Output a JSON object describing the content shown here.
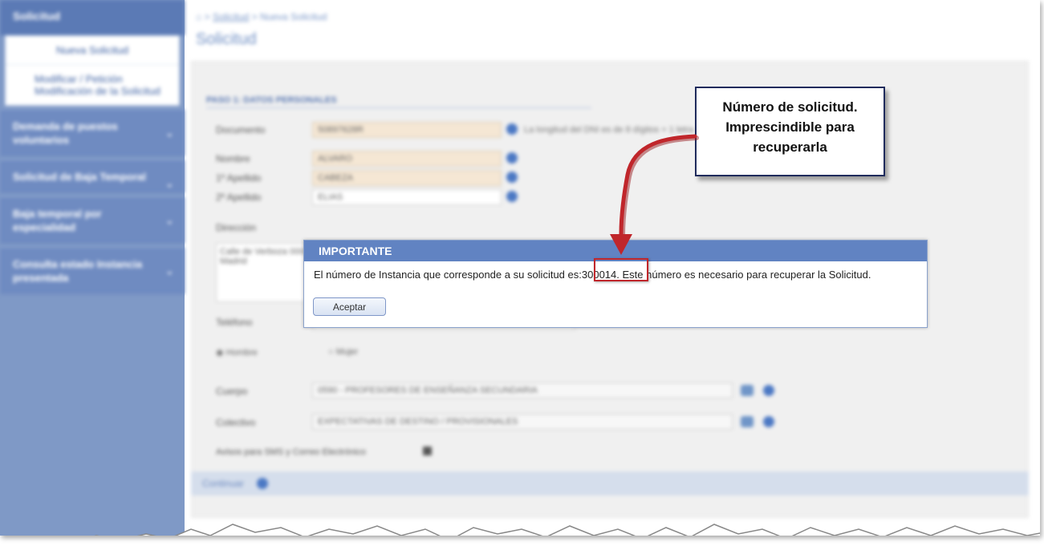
{
  "sidebar": {
    "header": "Solicitud",
    "sub_items": [
      {
        "label": "Nueva Solicitud"
      },
      {
        "label": "Modificar / Petición Modificación de la Solicitud"
      }
    ],
    "groups": [
      {
        "label": "Demanda de puestos voluntarios"
      },
      {
        "label": "Solicitud de Baja Temporal"
      },
      {
        "label": "Baja temporal por especialidad"
      },
      {
        "label": "Consulta estado Instancia presentada"
      }
    ]
  },
  "breadcrumb": {
    "home": "⌂",
    "sep1": ">",
    "link": "Solicitud",
    "sep2": ">",
    "current": "Nueva Solicitud"
  },
  "page_title": "Solicitud",
  "form": {
    "section_title": "PASO 1: DATOS PERSONALES",
    "labels": {
      "documento": "Documento",
      "nombre": "Nombre",
      "apellido1": "1º Apellido",
      "apellido2": "2º Apellido",
      "direccion": "Dirección",
      "telefono": "Teléfono",
      "cuerpo": "Cuerpo",
      "colectivo": "Colectivo",
      "avisos": "Avisos para SMS y Correo Electrónico"
    },
    "values": {
      "documento": "50897628R",
      "nombre": "ALVARO",
      "apellido1": "CABEZA",
      "apellido2": "ELIAS",
      "direccion": "Calle de Verboza 00001 Madrid",
      "cuerpo": "0590 - PROFESORES DE ENSEÑANZA SECUNDARIA",
      "colectivo": "EXPECTATIVAS DE DESTINO / PROVISIONALES"
    },
    "documento_hint": "La longitud del DNI es de 8 dígitos + 1 letra",
    "radio_hombre": "Hombre",
    "radio_mujer": "Mujer",
    "footer_label": "Continuar"
  },
  "dialog": {
    "title": "IMPORTANTE",
    "message_before": "El número de Instancia que corresponde a su solicitud es:",
    "instance_number": "300014",
    "message_after": ". Este número es necesario para recuperar la Solicitud.",
    "button_label": "Aceptar"
  },
  "callout": {
    "line1": "Número de solicitud.",
    "line2": "Imprescindible para",
    "line3": "recuperarla"
  },
  "colors": {
    "sidebar": "#7f99c6",
    "dialog_title": "#6183c2",
    "highlight": "#c0262b",
    "arrow": "#c0262b"
  }
}
